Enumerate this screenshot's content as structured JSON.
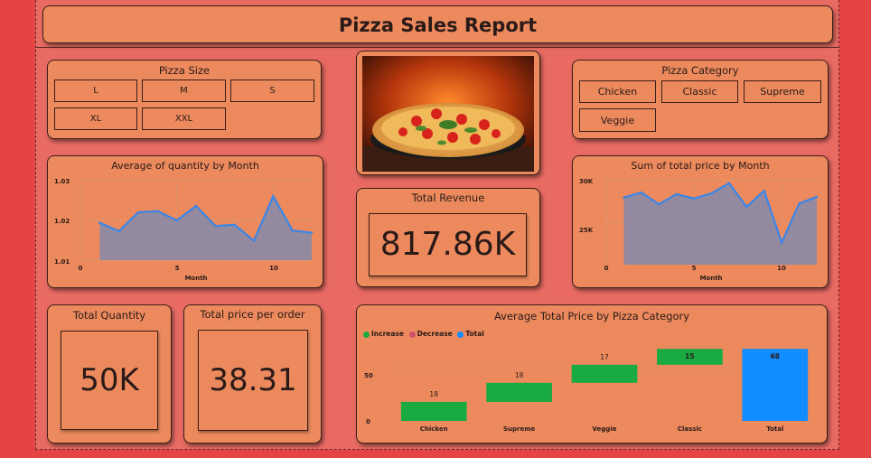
{
  "report": {
    "title": "Pizza Sales Report"
  },
  "pizza_size": {
    "title": "Pizza Size",
    "options": [
      "L",
      "M",
      "S",
      "XL",
      "XXL"
    ]
  },
  "pizza_category": {
    "title": "Pizza Category",
    "options": [
      "Chicken",
      "Classic",
      "Supreme",
      "Veggie"
    ]
  },
  "avg_quantity": {
    "title": "Average of quantity by Month",
    "xlabel": "Month",
    "y_ticks": [
      "1.03",
      "1.02",
      "1.01"
    ],
    "x_ticks": [
      "0",
      "5",
      "10"
    ]
  },
  "sum_price": {
    "title": "Sum of total price by Month",
    "xlabel": "Month",
    "y_ticks": [
      "30K",
      "25K"
    ],
    "x_ticks": [
      "0",
      "5",
      "10"
    ]
  },
  "total_revenue": {
    "title": "Total Revenue",
    "value": "817.86K"
  },
  "total_quantity": {
    "title": "Total Quantity",
    "value": "50K"
  },
  "total_price_per_order": {
    "title": "Total price per order",
    "value": "38.31"
  },
  "waterfall": {
    "title": "Average Total Price by Pizza Category",
    "legend": {
      "increase": "Increase",
      "decrease": "Decrease",
      "total": "Total"
    },
    "y_ticks": [
      "50",
      "0"
    ]
  },
  "colors": {
    "background": "#e44444",
    "card": "#ec8a5d",
    "line": "#3a86e8",
    "area": "#8b8aa6",
    "increase": "#1aaa42",
    "decrease": "#d2506a",
    "total": "#118dff"
  },
  "chart_data": [
    {
      "type": "area",
      "title": "Average of quantity by Month",
      "xlabel": "Month",
      "ylabel": "",
      "x": [
        1,
        2,
        3,
        4,
        5,
        6,
        7,
        8,
        9,
        10,
        11,
        12
      ],
      "values": [
        1.0193,
        1.0172,
        1.0219,
        1.0222,
        1.0199,
        1.0235,
        1.0185,
        1.0188,
        1.0148,
        1.0259,
        1.0174,
        1.0168
      ],
      "ylim": [
        1.01,
        1.03
      ],
      "xlim": [
        0,
        12
      ],
      "grid": true
    },
    {
      "type": "area",
      "title": "Sum of total price by Month",
      "xlabel": "Month",
      "ylabel": "",
      "x": [
        1,
        2,
        3,
        4,
        5,
        6,
        7,
        8,
        9,
        10,
        11,
        12
      ],
      "values": [
        27900,
        28500,
        27100,
        28300,
        27800,
        28400,
        29600,
        26800,
        28700,
        22600,
        27200,
        28000
      ],
      "ylim": [
        20000,
        30000
      ],
      "xlim": [
        0,
        12
      ],
      "grid": true
    },
    {
      "type": "bar",
      "subtype": "waterfall",
      "title": "Average Total Price by Pizza Category",
      "categories": [
        "Chicken",
        "Supreme",
        "Veggie",
        "Classic",
        "Total"
      ],
      "values": [
        18,
        18,
        17,
        15,
        68
      ],
      "kinds": [
        "increase",
        "increase",
        "increase",
        "increase",
        "total"
      ],
      "ylim": [
        0,
        75
      ],
      "legend": "top-left",
      "grid": true
    }
  ]
}
